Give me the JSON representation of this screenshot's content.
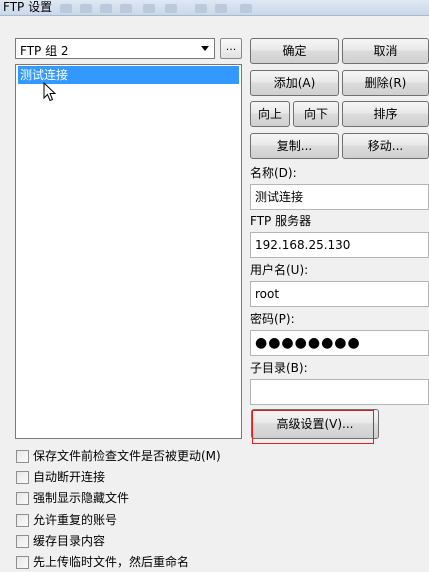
{
  "window": {
    "title": "FTP 设置"
  },
  "group_select": {
    "value": "FTP 组 2",
    "browse_label": "..."
  },
  "list": {
    "items": [
      "测试连接"
    ]
  },
  "buttons": {
    "ok": "确定",
    "cancel": "取消",
    "add": "添加(A)",
    "delete": "删除(R)",
    "up": "向上",
    "down": "向下",
    "sort": "排序",
    "copy": "复制...",
    "move": "移动...",
    "advanced": "高级设置(V)..."
  },
  "fields": {
    "name_label": "名称(D):",
    "name_value": "测试连接",
    "server_label": "FTP 服务器",
    "server_value": "192.168.25.130",
    "user_label": "用户名(U):",
    "user_value": "root",
    "password_label": "密码(P):",
    "password_value": "●●●●●●●●",
    "dir_label": "子目录(B):",
    "dir_value": ""
  },
  "checkboxes": [
    {
      "label": "保存文件前检查文件是否被更动(M)",
      "checked": false
    },
    {
      "label": "自动断开连接",
      "checked": false
    },
    {
      "label": "强制显示隐藏文件",
      "checked": false
    },
    {
      "label": "允许重复的账号",
      "checked": false
    },
    {
      "label": "缓存目录内容",
      "checked": false
    },
    {
      "label": "先上传临时文件，然后重命名",
      "checked": false
    }
  ],
  "colors": {
    "selection": "#3399ff",
    "highlight_box": "#d92020"
  }
}
